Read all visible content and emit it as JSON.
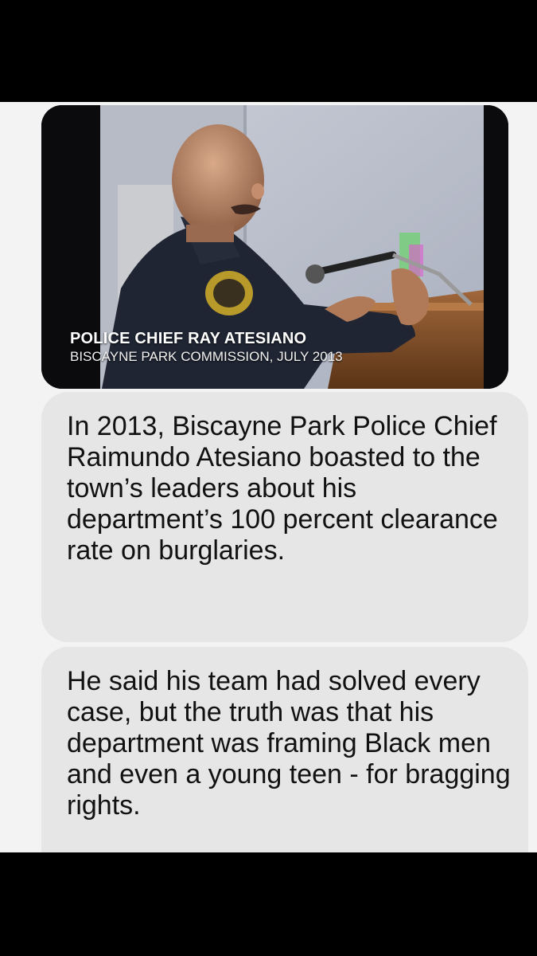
{
  "media": {
    "caption_title": "POLICE CHIEF RAY ATESIANO",
    "caption_subtitle": "BISCAYNE PARK COMMISSION, JULY 2013"
  },
  "messages": [
    {
      "text": "In 2013, Biscayne Park Police Chief Raimundo Atesiano boasted to the town’s leaders about his department’s 100 percent clearance rate on burglaries."
    },
    {
      "text": "He said his team had solved every case, but the truth was that his department was framing Black men and even a young teen - for bragging rights."
    }
  ],
  "colors": {
    "thread_background": "#f3f3f3",
    "bubble_background": "#e6e6e6",
    "frame": "#000000"
  }
}
